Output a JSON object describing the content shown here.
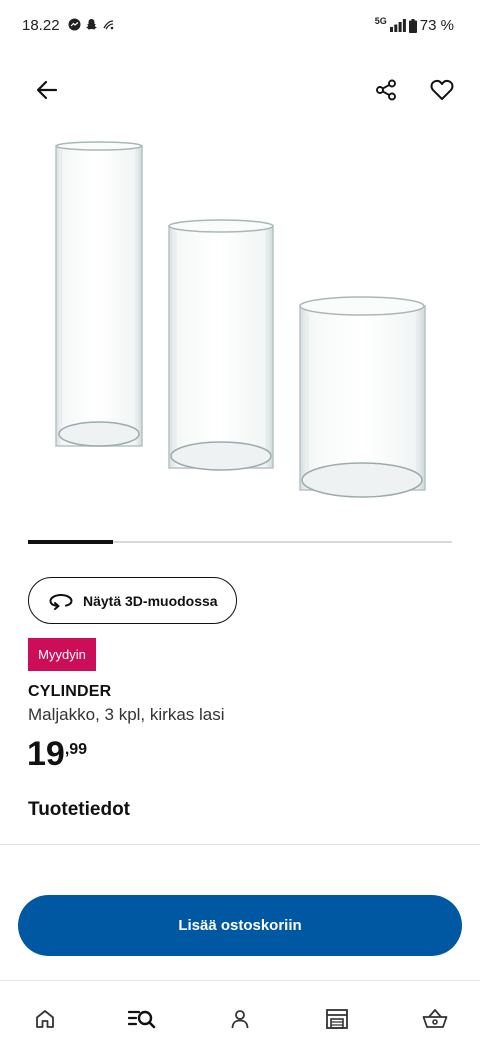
{
  "status_bar": {
    "time": "18.22",
    "network": "5G",
    "battery": "73 %"
  },
  "top_nav": {
    "back_icon": "arrow-left-icon",
    "share_icon": "share-icon",
    "favorite_icon": "heart-icon"
  },
  "gallery": {
    "image_alt": "three glass cylinder vases",
    "current_index_fraction": 0.2
  },
  "product": {
    "view_3d_label": "Näytä 3D-muodossa",
    "badge": "Myydyin",
    "name": "CYLINDER",
    "description": "Maljakko, 3 kpl, kirkas lasi",
    "price_integer": "19",
    "price_separator": ",",
    "price_decimal": "99"
  },
  "sections": {
    "product_details": "Tuotetiedot"
  },
  "actions": {
    "add_to_cart": "Lisää ostoskoriin"
  },
  "bottom_nav": {
    "items": [
      "home-icon",
      "search-icon",
      "profile-icon",
      "store-icon",
      "basket-icon"
    ]
  },
  "colors": {
    "accent_blue": "#0058a3",
    "badge_pink": "#cc0d58"
  }
}
